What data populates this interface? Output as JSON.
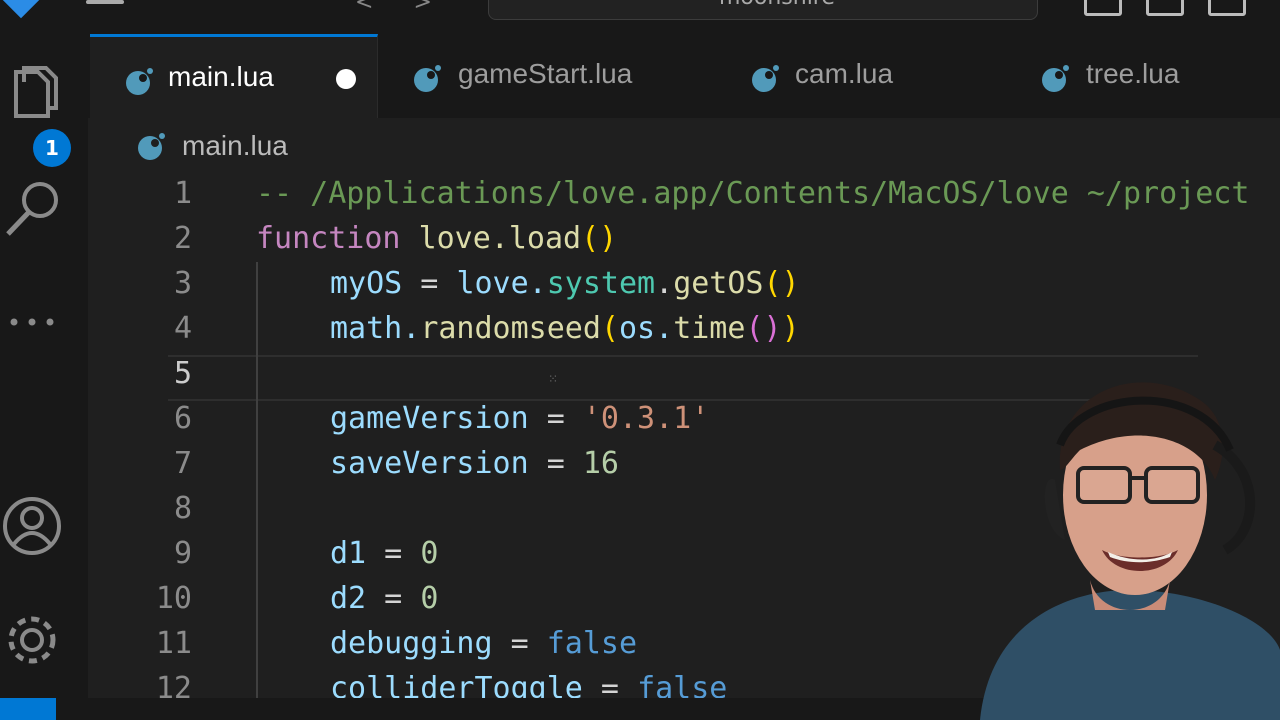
{
  "titlebar": {
    "search_text": "moonshire"
  },
  "activity": {
    "explorer_badge": "1"
  },
  "tabs": [
    {
      "label": "main.lua",
      "active": true,
      "dirty": true
    },
    {
      "label": "gameStart.lua",
      "active": false
    },
    {
      "label": "cam.lua",
      "active": false
    },
    {
      "label": "tree.lua",
      "active": false
    }
  ],
  "breadcrumb": {
    "file": "main.lua"
  },
  "editor": {
    "current_line": 5,
    "line_numbers": [
      "1",
      "2",
      "3",
      "4",
      "5",
      "6",
      "7",
      "8",
      "9",
      "10",
      "11",
      "12"
    ],
    "l1": {
      "comment": "-- /Applications/love.app/Contents/MacOS/love ~/project"
    },
    "l2": {
      "kw": "function",
      "fn": "love.load",
      "p": "()"
    },
    "l3": {
      "var": "myOS",
      "eq": " = ",
      "obj": "love.",
      "mod": "system",
      "dot": ".",
      "fn": "getOS",
      "p": "()"
    },
    "l4": {
      "obj": "math.",
      "fn": "randomseed",
      "p1": "(",
      "obj2": "os.",
      "fn2": "time",
      "p2": "()",
      "p3": ")"
    },
    "l6": {
      "var": "gameVersion",
      "eq": " = ",
      "str": "'0.3.1'"
    },
    "l7": {
      "var": "saveVersion",
      "eq": " = ",
      "num": "16"
    },
    "l9": {
      "var": "d1",
      "eq": " = ",
      "num": "0"
    },
    "l10": {
      "var": "d2",
      "eq": " = ",
      "num": "0"
    },
    "l11": {
      "var": "debugging",
      "eq": " = ",
      "bool": "false"
    },
    "l12": {
      "var": "colliderToggle",
      "eq": " = ",
      "bool": "false"
    }
  },
  "colors": {
    "accent": "#0078d4",
    "lua_icon": "#519aba"
  }
}
